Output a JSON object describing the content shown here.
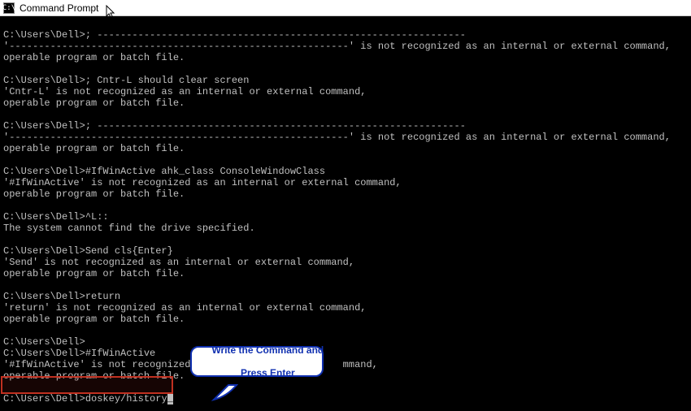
{
  "window": {
    "title": "Command Prompt",
    "icon_label": "C:\\"
  },
  "prompt": "C:\\Users\\Dell>",
  "lines": {
    "l1": "C:\\Users\\Dell>; ---------------------------------------------------------------",
    "l2": "'----------------------------------------------------------' is not recognized as an internal or external command,",
    "l3": "operable program or batch file.",
    "blank": "",
    "l4": "C:\\Users\\Dell>; Cntr-L should clear screen",
    "l5": "'Cntr-L' is not recognized as an internal or external command,",
    "l6": "operable program or batch file.",
    "l7": "C:\\Users\\Dell>; ---------------------------------------------------------------",
    "l8": "'----------------------------------------------------------' is not recognized as an internal or external command,",
    "l9": "operable program or batch file.",
    "l10": "C:\\Users\\Dell>#IfWinActive ahk_class ConsoleWindowClass",
    "l11": "'#IfWinActive' is not recognized as an internal or external command,",
    "l12": "operable program or batch file.",
    "l13": "C:\\Users\\Dell>^L::",
    "l14": "The system cannot find the drive specified.",
    "l15": "C:\\Users\\Dell>Send cls{Enter}",
    "l16": "'Send' is not recognized as an internal or external command,",
    "l17": "operable program or batch file.",
    "l18": "C:\\Users\\Dell>return",
    "l19": "'return' is not recognized as an internal or external command,",
    "l20": "operable program or batch file.",
    "l21": "C:\\Users\\Dell>",
    "l22": "C:\\Users\\Dell>#IfWinActive",
    "l23a": "'#IfWinActive' is not recognized",
    "l23c": "mmand,",
    "l24": "operable program or batch file.",
    "l25p": "C:\\Users\\Dell>",
    "l25c": "doskey/history"
  },
  "callout": {
    "line1": "Write the Command and",
    "line2": "Press Enter"
  },
  "current_command": "doskey/history"
}
